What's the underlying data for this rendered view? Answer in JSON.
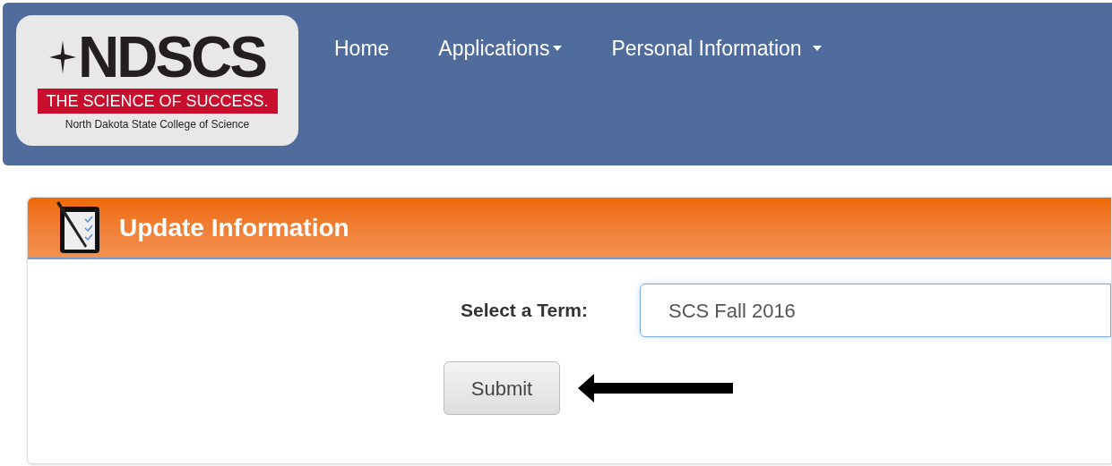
{
  "logo": {
    "wordmark": "NDSCS",
    "tagline": "THE SCIENCE OF SUCCESS.",
    "name": "North Dakota State College of Science"
  },
  "nav": [
    {
      "label": "Home",
      "dropdown": false
    },
    {
      "label": "Applications",
      "dropdown": true
    },
    {
      "label": "Personal Information",
      "dropdown": true
    }
  ],
  "panel": {
    "title": "Update Information",
    "term_label": "Select a Term:",
    "term_value": "SCS Fall 2016",
    "submit": "Submit"
  }
}
